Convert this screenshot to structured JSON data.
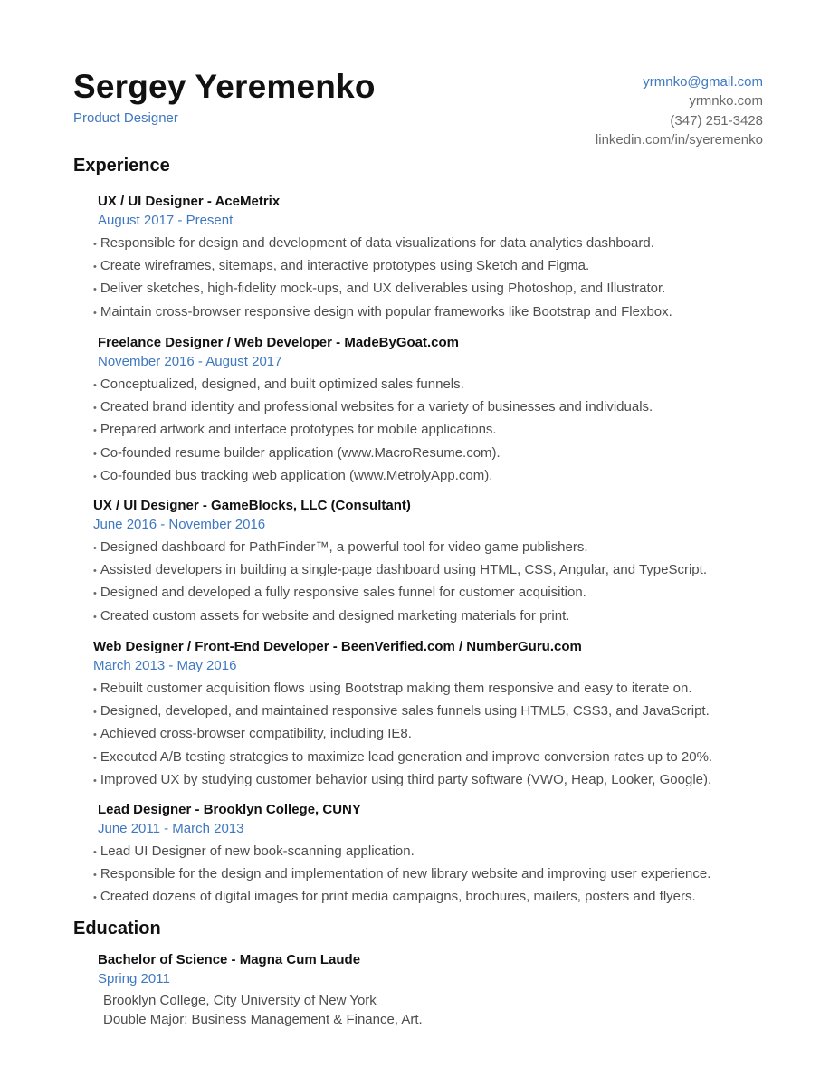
{
  "header": {
    "name": "Sergey Yeremenko",
    "role": "Product Designer",
    "contact": {
      "email": "yrmnko@gmail.com",
      "website": "yrmnko.com",
      "phone": "(347) 251-3428",
      "linkedin": "linkedin.com/in/syeremenko"
    }
  },
  "sections": {
    "experience_title": "Experience",
    "education_title": "Education"
  },
  "bullet": "•",
  "experience": [
    {
      "title": "UX / UI Designer - AceMetrix",
      "dates": "August 2017 - Present",
      "bullets": [
        "Responsible for design and development of data visualizations for data analytics dashboard.",
        "Create wireframes, sitemaps, and interactive prototypes using Sketch and Figma.",
        "Deliver sketches, high-fidelity mock-ups, and UX deliverables using Photoshop, and Illustrator.",
        "Maintain cross-browser responsive design with popular frameworks like Bootstrap and Flexbox."
      ]
    },
    {
      "title": "Freelance Designer / Web Developer - MadeByGoat.com",
      "dates": "November 2016 - August 2017",
      "bullets": [
        "Conceptualized, designed, and built optimized sales funnels.",
        "Created brand identity and professional websites for a variety of businesses and individuals.",
        "Prepared artwork and interface prototypes for mobile applications.",
        "Co-founded resume builder application (www.MacroResume.com).",
        "Co-founded bus tracking web application (www.MetrolyApp.com)."
      ]
    },
    {
      "title": "UX / UI Designer - GameBlocks, LLC (Consultant)",
      "dates": "June 2016 - November 2016",
      "bullets": [
        "Designed dashboard for PathFinder™, a powerful tool for video game publishers.",
        "Assisted developers in building a single-page dashboard using HTML, CSS, Angular, and TypeScript.",
        "Designed and developed a fully responsive sales funnel for customer acquisition.",
        "Created custom assets for website and designed marketing materials for print."
      ]
    },
    {
      "title": "Web Designer / Front-End Developer - BeenVerified.com / NumberGuru.com",
      "dates": "March 2013 - May 2016",
      "bullets": [
        "Rebuilt customer acquisition flows using Bootstrap making them responsive and easy to iterate on.",
        "Designed, developed, and maintained responsive sales funnels using HTML5, CSS3, and JavaScript.",
        "Achieved cross-browser compatibility, including IE8.",
        "Executed A/B testing strategies to maximize lead generation and improve conversion rates up to 20%.",
        "Improved UX by studying customer behavior using third party software (VWO, Heap, Looker, Google)."
      ]
    },
    {
      "title": "Lead Designer - Brooklyn College, CUNY",
      "dates": "June 2011 - March 2013",
      "bullets": [
        "Lead UI Designer of new book-scanning application.",
        "Responsible for the design and implementation of new library website and improving user experience.",
        "Created dozens of digital images for print media campaigns, brochures, mailers, posters and flyers."
      ]
    }
  ],
  "education": {
    "degree": "Bachelor of Science - Magna Cum Laude",
    "dates": "Spring 2011",
    "lines": [
      "Brooklyn College, City University of New York",
      "Double Major: Business Management & Finance, Art."
    ]
  }
}
